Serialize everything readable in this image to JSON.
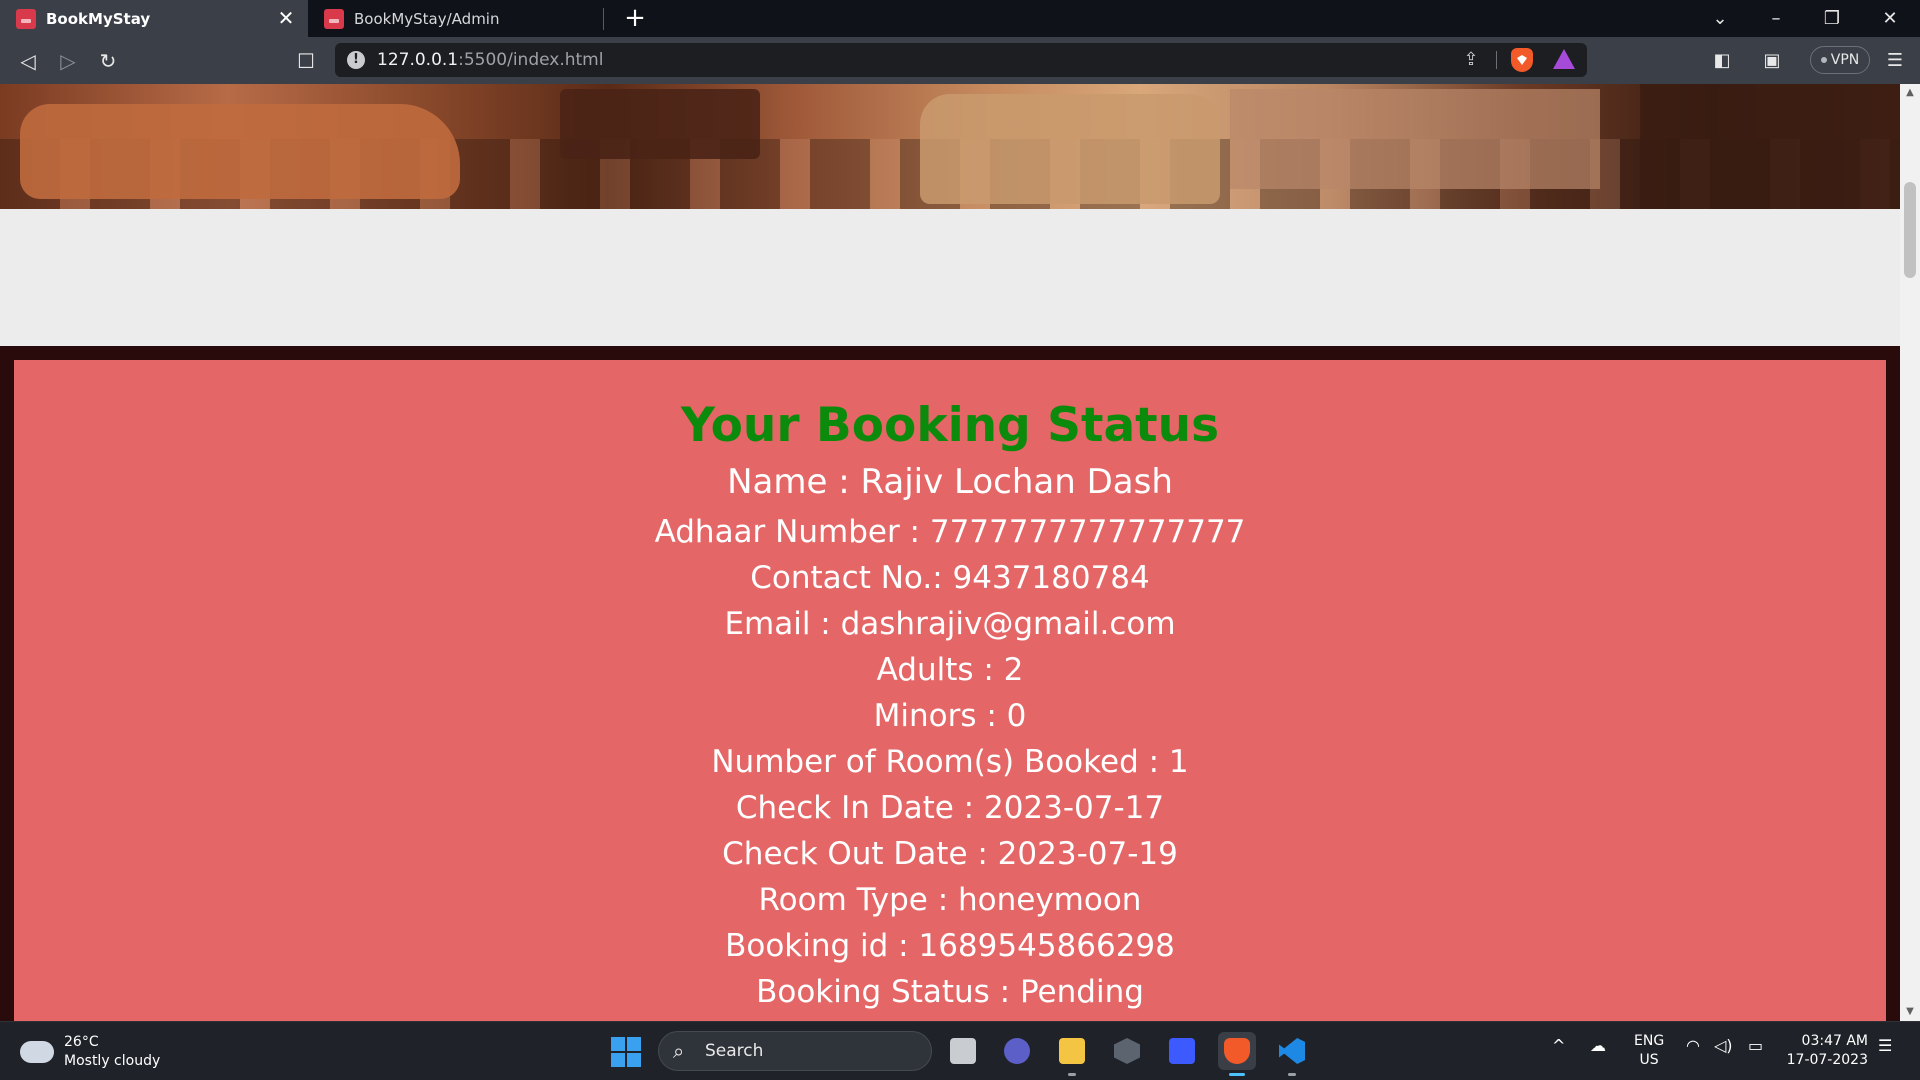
{
  "browser": {
    "tabs": [
      {
        "label": "BookMyStay",
        "active": true
      },
      {
        "label": "BookMyStay/Admin",
        "active": false
      }
    ],
    "tab_close_glyph": "✕",
    "new_tab_glyph": "+",
    "window_controls": {
      "tab_search": "⌄",
      "minimize": "–",
      "restore": "❐",
      "close": "✕"
    },
    "nav": {
      "back": "◁",
      "forward": "▷",
      "reload": "↻",
      "bookmark": "☐"
    },
    "url": {
      "host": "127.0.0.1",
      "rest": ":5500/index.html"
    },
    "url_info_glyph": "!",
    "share_glyph": "⇪",
    "vpn_label": "VPN",
    "menu_glyph": "☰",
    "sidebar_glyph": "◧",
    "wallet_glyph": "▣"
  },
  "page": {
    "heading": "Your Booking Status",
    "details": [
      "Name : Rajiv Lochan Dash",
      "Adhaar Number : 7777777777777777",
      "Contact No.: 9437180784",
      "Email : dashrajiv@gmail.com",
      "Adults : 2",
      "Minors : 0",
      "Number of Room(s) Booked : 1",
      "Check In Date : 2023-07-17",
      "Check Out Date : 2023-07-19",
      "Room Type : honeymoon",
      "Booking id : 1689545866298",
      "Booking Status : Pending"
    ],
    "colors": {
      "card": "#e56666",
      "heading": "#0c8a0c",
      "frame": "#2a0b0b"
    }
  },
  "scrollbar": {
    "up": "▲",
    "down": "▼"
  },
  "taskbar": {
    "weather": {
      "temp": "26°C",
      "desc": "Mostly cloudy"
    },
    "search_label": "Search",
    "search_glyph": "⌕",
    "apps": [
      "file-explorer-stack",
      "meet",
      "file-explorer",
      "unity",
      "app-blue",
      "brave",
      "vscode"
    ],
    "tray": {
      "chevron": "^",
      "onedrive": "☁",
      "wifi": "◠",
      "volume": "◁)",
      "battery": "▭"
    },
    "language": {
      "lang": "ENG",
      "region": "US"
    },
    "clock": {
      "time": "03:47 AM",
      "date": "17-07-2023"
    },
    "notification_glyph": "☰"
  }
}
